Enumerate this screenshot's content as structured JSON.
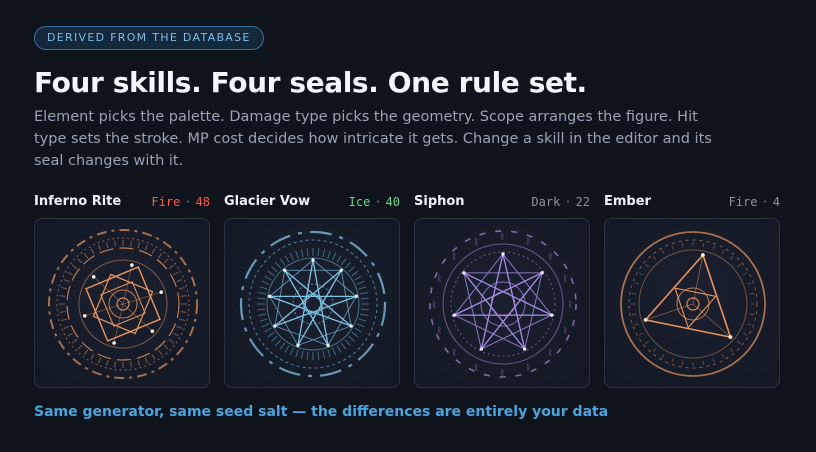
{
  "header": {
    "badge": "DERIVED FROM THE DATABASE",
    "title": "Four skills. Four seals. One rule set.",
    "description": "Element picks the palette. Damage type picks the geometry. Scope arranges the figure. Hit type sets the stroke. MP cost decides how intricate it gets. Change a skill in the editor and its seal changes with it."
  },
  "cards": [
    {
      "name": "Inferno Rite",
      "element": "Fire",
      "cost": "48",
      "element_color": "#ff5a4a",
      "seal_color": "#e9935a",
      "separator": "·",
      "icon": "inferno-seal-icon"
    },
    {
      "name": "Glacier Vow",
      "element": "Ice",
      "cost": "40",
      "element_color": "#5fdc8a",
      "seal_color": "#7cc4e6",
      "separator": "·",
      "icon": "glacier-seal-icon"
    },
    {
      "name": "Siphon",
      "element": "Dark",
      "cost": "22",
      "element_color": "#8a93a2",
      "seal_color": "#a98be6",
      "separator": "·",
      "icon": "siphon-seal-icon"
    },
    {
      "name": "Ember",
      "element": "Fire",
      "cost": "4",
      "element_color": "#8a93a2",
      "seal_color": "#e9935a",
      "separator": "·",
      "icon": "ember-seal-icon"
    }
  ],
  "footer": {
    "note": "Same generator, same seed salt — the differences are entirely your data"
  }
}
